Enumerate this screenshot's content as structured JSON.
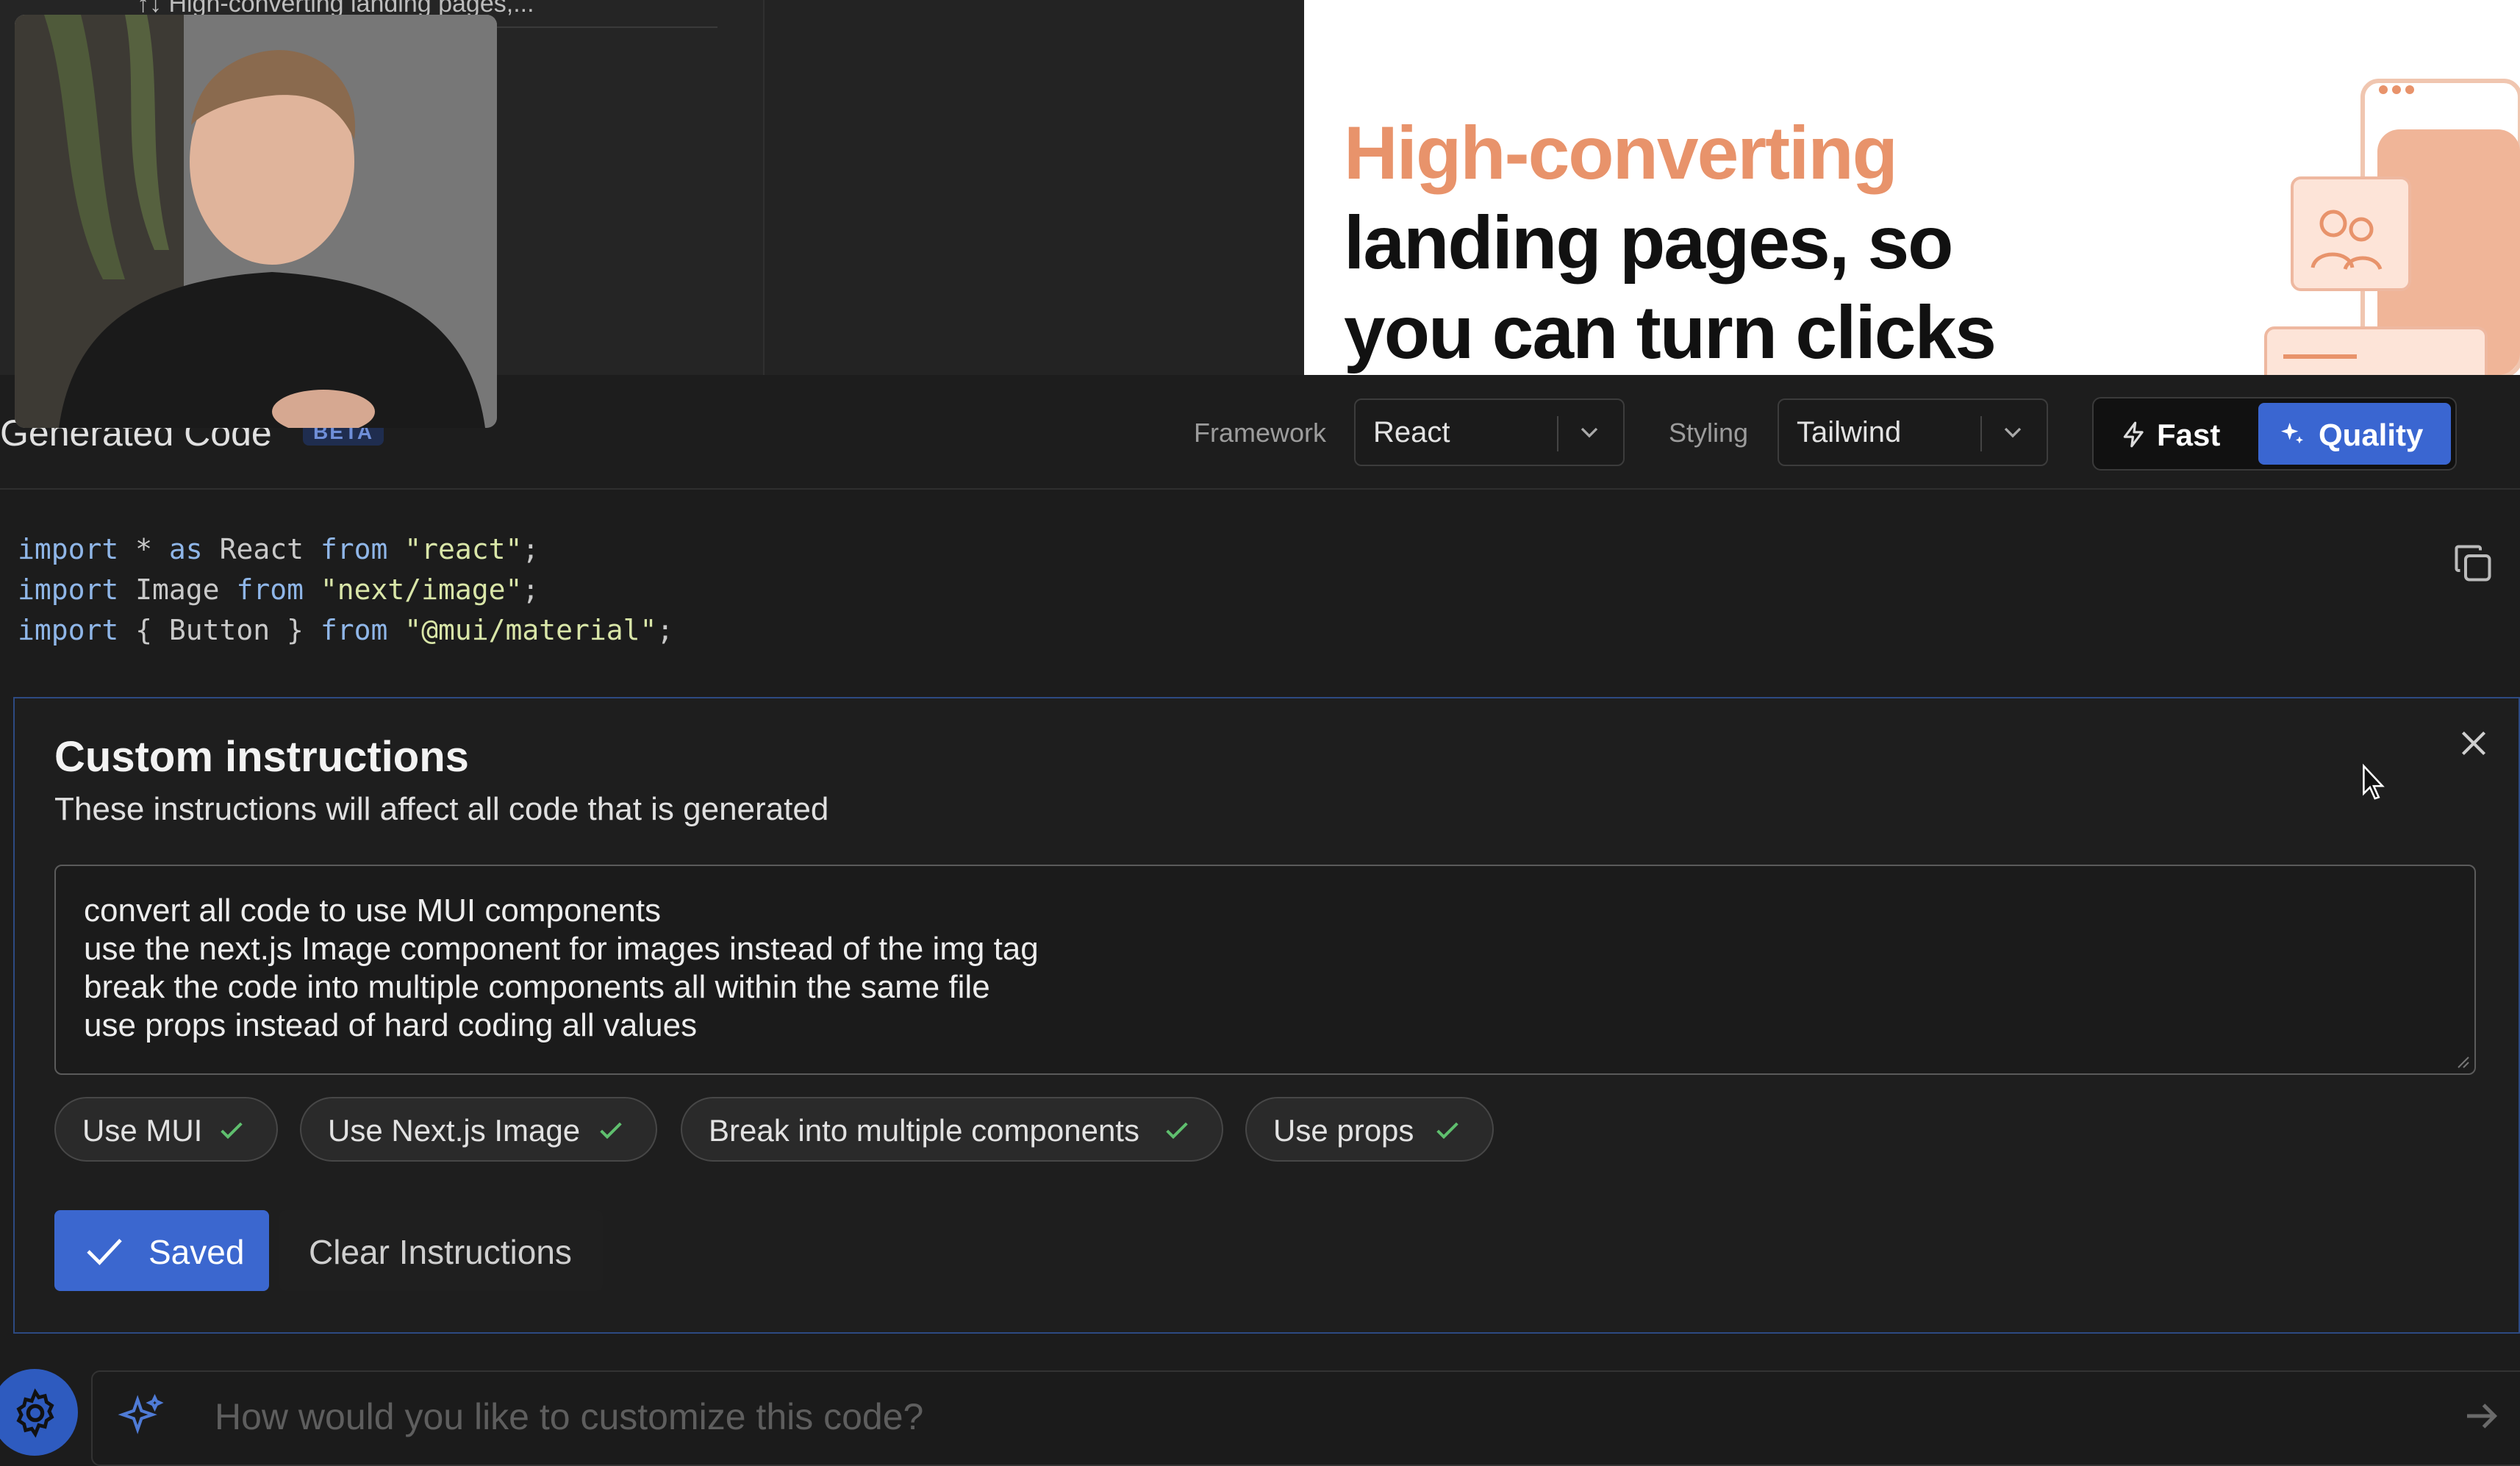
{
  "sidebar": {
    "file_label": "↑↓ High-converting landing pages,..."
  },
  "preview": {
    "headline_accent": "High-converting",
    "headline_line2": "landing pages,  so",
    "headline_line3": "you can turn  clicks"
  },
  "toolbar": {
    "title": "Generated Code",
    "badge": "BETA",
    "framework_label": "Framework",
    "framework_value": "React",
    "styling_label": "Styling",
    "styling_value": "Tailwind",
    "mode_fast": "Fast",
    "mode_quality": "Quality",
    "mode_selected": "Quality"
  },
  "code": {
    "lines": [
      {
        "kw1": "import",
        "mid": " * ",
        "kw2": "as",
        "name": " React ",
        "kw3": "from",
        "str": " \"react\"",
        "end": ";"
      },
      {
        "kw1": "import",
        "mid": " Image ",
        "kw2": "",
        "name": "",
        "kw3": "from",
        "str": " \"next/image\"",
        "end": ";"
      },
      {
        "kw1": "import",
        "mid": " { Button } ",
        "kw2": "",
        "name": "",
        "kw3": "from",
        "str": " \"@mui/material\"",
        "end": ";"
      }
    ]
  },
  "custom_instructions": {
    "title": "Custom instructions",
    "subtitle": "These instructions will affect all code that is generated",
    "text_lines": [
      "convert all code to use MUI components",
      "use the next.js Image component for images instead of the img tag",
      "break the code into multiple components all within the same file",
      "use props instead of hard coding all values"
    ],
    "chips": [
      "Use MUI",
      "Use Next.js Image",
      "Break into multiple components",
      "Use props"
    ],
    "saved_label": "Saved",
    "clear_label": "Clear Instructions"
  },
  "prompt": {
    "placeholder": "How would you like to customize this code?"
  },
  "colors": {
    "accent": "#3a66d1",
    "orange": "#e8936b",
    "check": "#5fbf6e"
  }
}
